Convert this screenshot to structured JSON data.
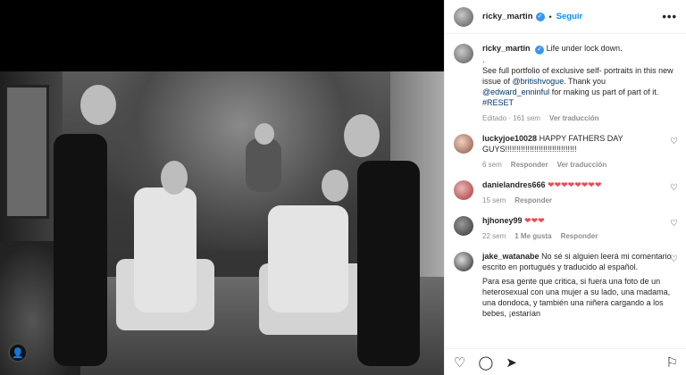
{
  "post": {
    "author": "ricky_martin",
    "follow_label": "Seguir",
    "more_label": "•••",
    "separator": "•"
  },
  "caption": {
    "author": "ricky_martin",
    "line1": "Life under lock down.",
    "line2": ".",
    "line3_a": "See full portfolio of exclusive self- portraits in this new issue of ",
    "mention1": "@britishvogue",
    "line3_b": ". Thank you ",
    "mention2": "@edward_enninful",
    "line3_c": " for making us part of part of it. ",
    "hashtag": "#RESET",
    "edited": "Editado · 161 sem",
    "see_translation": "Ver traducción"
  },
  "comments": [
    {
      "user": "luckyjoe10028",
      "text": "HAPPY FATHERS DAY GUYS!!!!!!!!!!!!!!!!!!!!!!!!!!!!!!!!",
      "time": "6 sem",
      "reply": "Responder",
      "translate": "Ver traducción"
    },
    {
      "user": "danielandres666",
      "text": "❤❤❤❤❤❤❤❤",
      "time": "15 sem",
      "reply": "Responder"
    },
    {
      "user": "hjhoney99",
      "text": "❤❤❤",
      "time": "22 sem",
      "likes": "1 Me gusta",
      "reply": "Responder"
    },
    {
      "user": "jake_watanabe",
      "text": "No sé si alguien leerá mi comentario escrito en portugués y traducido al español.",
      "text2": "Para esa gente que critica, si fuera una foto de un heterosexual con una mujer a su lado, una madama, una dondoca, y también una niñera cargando a los bebes, ¡estarían"
    }
  ],
  "icons": {
    "heart": "heart-icon",
    "comment": "comment-icon",
    "share": "share-icon",
    "save": "bookmark-icon",
    "verified": "verified-icon"
  }
}
